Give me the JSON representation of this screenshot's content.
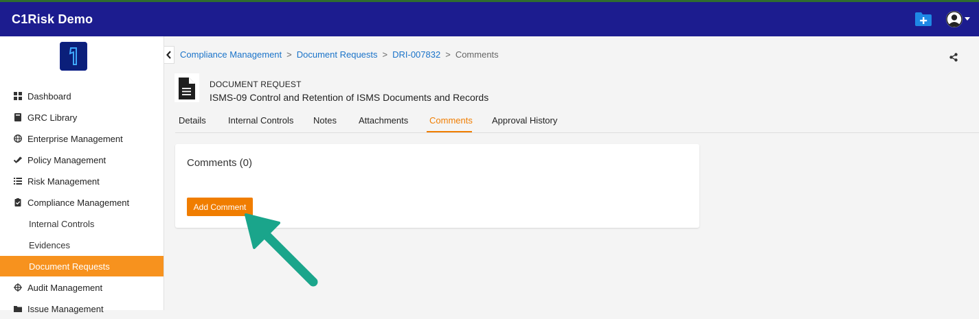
{
  "app": {
    "title": "C1Risk Demo"
  },
  "colors": {
    "topbar": "#1c1c8f",
    "accent": "#f07d00",
    "active_nav": "#f7921e",
    "link": "#1a73c9",
    "arrow": "#1aa58b"
  },
  "sidebar": {
    "items": [
      {
        "label": "Dashboard",
        "icon": "dashboard-icon"
      },
      {
        "label": "GRC Library",
        "icon": "book-icon"
      },
      {
        "label": "Enterprise Management",
        "icon": "globe-icon"
      },
      {
        "label": "Policy Management",
        "icon": "check-double-icon"
      },
      {
        "label": "Risk Management",
        "icon": "list-icon"
      },
      {
        "label": "Compliance Management",
        "icon": "clipboard-check-icon"
      },
      {
        "label": "Internal Controls",
        "sub": true
      },
      {
        "label": "Evidences",
        "sub": true
      },
      {
        "label": "Document Requests",
        "sub": true,
        "active": true
      },
      {
        "label": "Audit Management",
        "icon": "crosshair-icon"
      },
      {
        "label": "Issue Management",
        "icon": "folder-icon"
      }
    ]
  },
  "breadcrumb": {
    "items": [
      "Compliance Management",
      "Document Requests",
      "DRI-007832"
    ],
    "current": "Comments",
    "separator": ">"
  },
  "record": {
    "type": "DOCUMENT REQUEST",
    "title": "ISMS-09 Control and Retention of ISMS Documents and Records"
  },
  "tabs": [
    "Details",
    "Internal Controls",
    "Notes",
    "Attachments",
    "Comments",
    "Approval History"
  ],
  "active_tab": "Comments",
  "comments": {
    "heading": "Comments (0)",
    "add_button": "Add Comment"
  }
}
